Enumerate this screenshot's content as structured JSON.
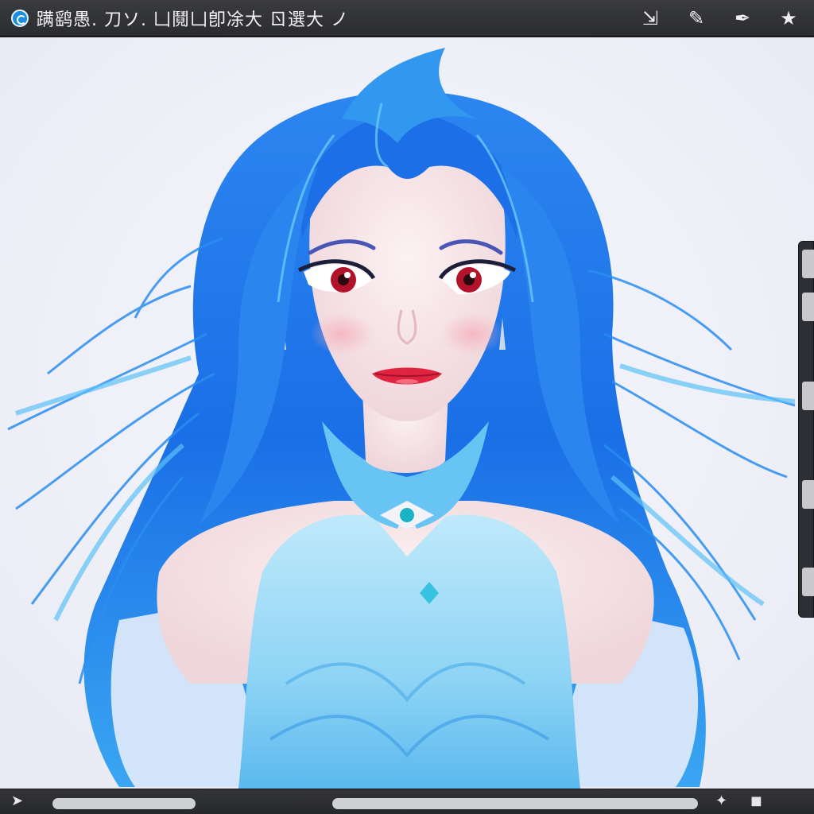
{
  "window": {
    "title": "蹒鹞愚. 刀ソ. 凵鬩凵卽凃大 ㄖ選大 ノ",
    "logo_icon": "app-logo-icon"
  },
  "toolbar": {
    "icons": [
      {
        "name": "export-icon",
        "glyph": "⇲"
      },
      {
        "name": "brush-icon",
        "glyph": "✎"
      },
      {
        "name": "pen-icon",
        "glyph": "✒"
      },
      {
        "name": "star-icon",
        "glyph": "★"
      }
    ]
  },
  "bottom_bar": {
    "left_icon": {
      "name": "arrow-icon",
      "glyph": "➤"
    },
    "right_icons": [
      {
        "name": "settings-icon",
        "glyph": "✦"
      },
      {
        "name": "square-icon",
        "glyph": "◼"
      }
    ]
  },
  "colors": {
    "canvas_bg": "#eff0f7",
    "hair": "#1f7fe8",
    "hair_light": "#47b2f5",
    "dress": "#9fdcf6",
    "skin": "#f6e4e6",
    "lips": "#e0243f",
    "eyes": "#b3122b"
  }
}
